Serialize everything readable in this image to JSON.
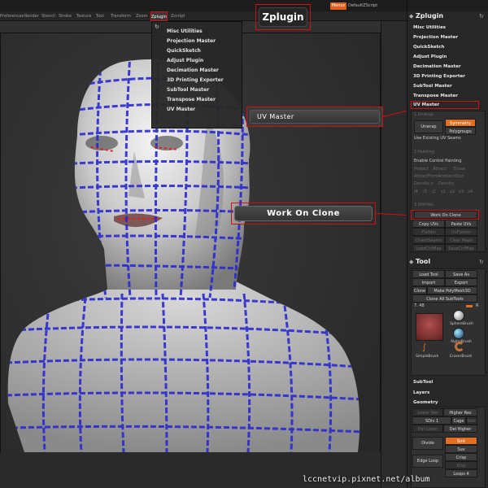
{
  "menubar": {
    "items": [
      "Preferences",
      "Render",
      "Stencil",
      "Stroke",
      "Texture",
      "Tool",
      "Transform",
      "Zoom",
      "Zplugin",
      "Zscript"
    ]
  },
  "topbar": {
    "menus_label": "Menus",
    "script_label": "DefaultZScript"
  },
  "zplugin_menu": {
    "items": [
      "Misc Utilities",
      "Projection Master",
      "QuickSketch",
      "Adjust Plugin",
      "Decimation Master",
      "3D Printing Exporter",
      "SubTool Master",
      "Transpose Master",
      "UV Master"
    ]
  },
  "callouts": {
    "zplugin": "Zplugin",
    "uv_master": "UV Master",
    "work_on_clone": "Work On Clone"
  },
  "panel": {
    "zplugin_title": "Zplugin",
    "zplugin_items": [
      "Misc Utilities",
      "Projection Master",
      "QuickSketch",
      "Adjust Plugin",
      "Decimation Master",
      "3D Printing Exporter",
      "SubTool Master",
      "Transpose Master",
      "UV Master"
    ],
    "uv": {
      "unwrap_section": "1 Unwrap",
      "unwrap": "Unwrap",
      "symmetry": "Symmetry",
      "polygroups": "Polygroups",
      "use_existing": "Use Existing UV Seams",
      "painting_section": "2 Painting",
      "enable_control": "Enable Control Painting",
      "protect": "Protect",
      "attract": "Attract",
      "erase": "Erase",
      "attract_ambient": "AttractFromAmbientOccl",
      "density": "Density x",
      "density_label": "Density",
      "density_values": [
        "/4",
        "/3",
        "/2",
        "x1",
        "x2",
        "x3",
        "x4"
      ],
      "utilities_section": "3 Utilities",
      "work_on_clone": "Work On Clone",
      "copy_uvs": "Copy UVs",
      "paste_uvs": "Paste UVs",
      "flatten": "Flatten",
      "unflatten": "UnFlatten",
      "checkseams": "CheckSeams",
      "clear_maps": "Clear Maps",
      "load_ctl": "LoadCtrlMap",
      "save_ctl": "SaveCtrlMap"
    },
    "tool_title": "Tool",
    "tool": {
      "load_tool": "Load Tool",
      "save_as": "Save As",
      "import": "Import",
      "export": "Export",
      "clone": "Clone",
      "make_polymesh": "Make PolyMesh3D",
      "clone_all": "Clone All SubTools",
      "value": "7. 48",
      "r": "R",
      "sphere_brush": "SphereBrush",
      "alpha_brush": "AlphaBrush",
      "simple_brush": "SimpleBrush",
      "eraser_brush": "EraserBrush"
    },
    "subtool": "SubTool",
    "layers": "Layers",
    "geometry": {
      "title": "Geometry",
      "lower_res": "Lower Res",
      "higher_res": "Higher Res",
      "sdiv": "SDiv 1",
      "cage": "Cage",
      "rstr": "Rstr",
      "del_lower": "Del Lower",
      "del_higher": "Del Higher",
      "divide": "Divide",
      "smt": "Smt",
      "suv": "Suv",
      "edge_loop": "Edge Loop",
      "crisp": "Crisp",
      "disp": "Disp",
      "loops": "Loops 4"
    }
  },
  "watermark": "lccnetvip.pixnet.net/album",
  "colors": {
    "callout_red": "#d01010",
    "accent_orange": "#e07020",
    "wire_blue": "#2a2ad0"
  }
}
